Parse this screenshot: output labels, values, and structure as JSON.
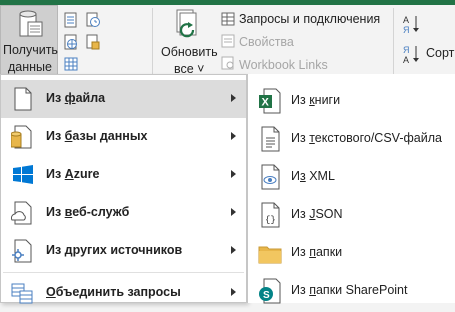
{
  "ribbon": {
    "get_data": {
      "line1": "Получить",
      "line2": "данные"
    },
    "refresh_all": {
      "line1": "Обновить",
      "line2": "все"
    },
    "queries_connections": "Запросы и подключения",
    "properties": "Свойства",
    "workbook_links": "Workbook Links",
    "sort": "Сорти"
  },
  "menu": {
    "items": [
      {
        "pre": "Из ",
        "hot": "ф",
        "post": "айла"
      },
      {
        "pre": "Из ",
        "hot": "б",
        "post": "азы данных"
      },
      {
        "pre": "Из ",
        "hot": "A",
        "post": "zure"
      },
      {
        "pre": "Из ",
        "hot": "в",
        "post": "еб-служб"
      },
      {
        "pre": "Из ",
        "hot": "д",
        "post": "ругих источников"
      },
      {
        "pre": "",
        "hot": "О",
        "post": "бъединить запросы"
      }
    ]
  },
  "submenu": {
    "items": [
      {
        "pre": "Из ",
        "hot": "к",
        "post": "ниги"
      },
      {
        "pre": "Из ",
        "hot": "т",
        "post": "екстового/CSV-файла"
      },
      {
        "pre": "И",
        "hot": "з",
        "post": " XML"
      },
      {
        "pre": "Из ",
        "hot": "J",
        "post": "SON"
      },
      {
        "pre": "Из ",
        "hot": "п",
        "post": "апки"
      },
      {
        "pre": "Из ",
        "hot": "п",
        "post": "апки SharePoint"
      }
    ]
  },
  "colors": {
    "excel_green": "#217346",
    "azure_blue": "#0078d4",
    "folder": "#e8b64a",
    "accent_blue": "#4a7fc1"
  }
}
